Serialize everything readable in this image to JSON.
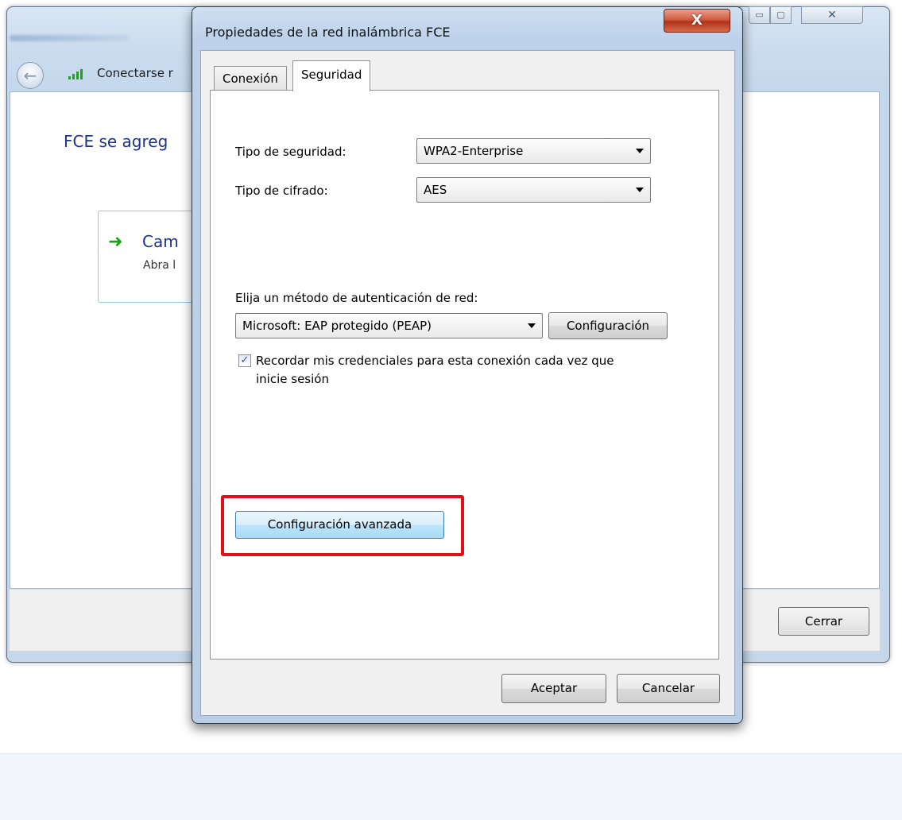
{
  "background_window": {
    "title": "Conectarse manualmente a una red inalámbrica",
    "title_visible": "Conectarse r",
    "heading": "FCE se agregó correctamente",
    "heading_visible": "FCE se agreg",
    "option_title": "Cam",
    "option_subtitle": "Abra l",
    "close_button": "Cerrar",
    "caption_min": "▭",
    "caption_max": "▢",
    "caption_close": "✕",
    "back_icon": "arrow-left-icon",
    "signal_icon": "wifi-signal-icon"
  },
  "dialog": {
    "title": "Propiedades de la red inalámbrica FCE",
    "close_glyph": "X",
    "tabs": [
      {
        "label": "Conexión",
        "active": false
      },
      {
        "label": "Seguridad",
        "active": true
      }
    ],
    "security_type_label": "Tipo de seguridad:",
    "security_type_value": "WPA2-Enterprise",
    "encryption_label": "Tipo de cifrado:",
    "encryption_value": "AES",
    "auth_method_label": "Elija un método de autenticación de red:",
    "auth_method_value": "Microsoft: EAP protegido (PEAP)",
    "config_button": "Configuración",
    "remember_checkbox_label": "Recordar mis credenciales para esta conexión cada vez que inicie sesión",
    "remember_checkbox_checked": true,
    "check_glyph": "✓",
    "advanced_button": "Configuración avanzada",
    "ok_button": "Aceptar",
    "cancel_button": "Cancelar"
  },
  "colors": {
    "highlight": "#e0101a",
    "title_bar": "#bdd2ea",
    "close_button": "#c8462a",
    "heading_blue": "#1e3287"
  }
}
